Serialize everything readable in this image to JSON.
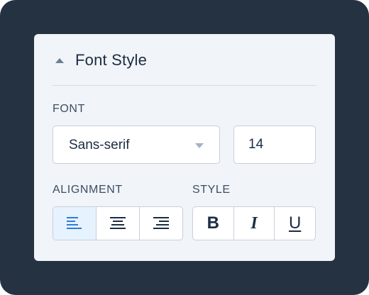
{
  "panel": {
    "title": "Font Style",
    "collapse_icon": "chevron-up-icon"
  },
  "font": {
    "label": "FONT",
    "family_value": "Sans-serif",
    "size_value": "14"
  },
  "alignment": {
    "label": "ALIGNMENT",
    "selected": "left",
    "options": [
      "align-left-icon",
      "align-center-icon",
      "align-right-icon"
    ]
  },
  "style": {
    "label": "STYLE",
    "bold_label": "B",
    "italic_label": "I",
    "underline_label": "U"
  },
  "colors": {
    "background": "#243242",
    "panel": "#f1f4f8",
    "accent": "#2b7fd6",
    "active_fill": "#e6f2fd"
  }
}
